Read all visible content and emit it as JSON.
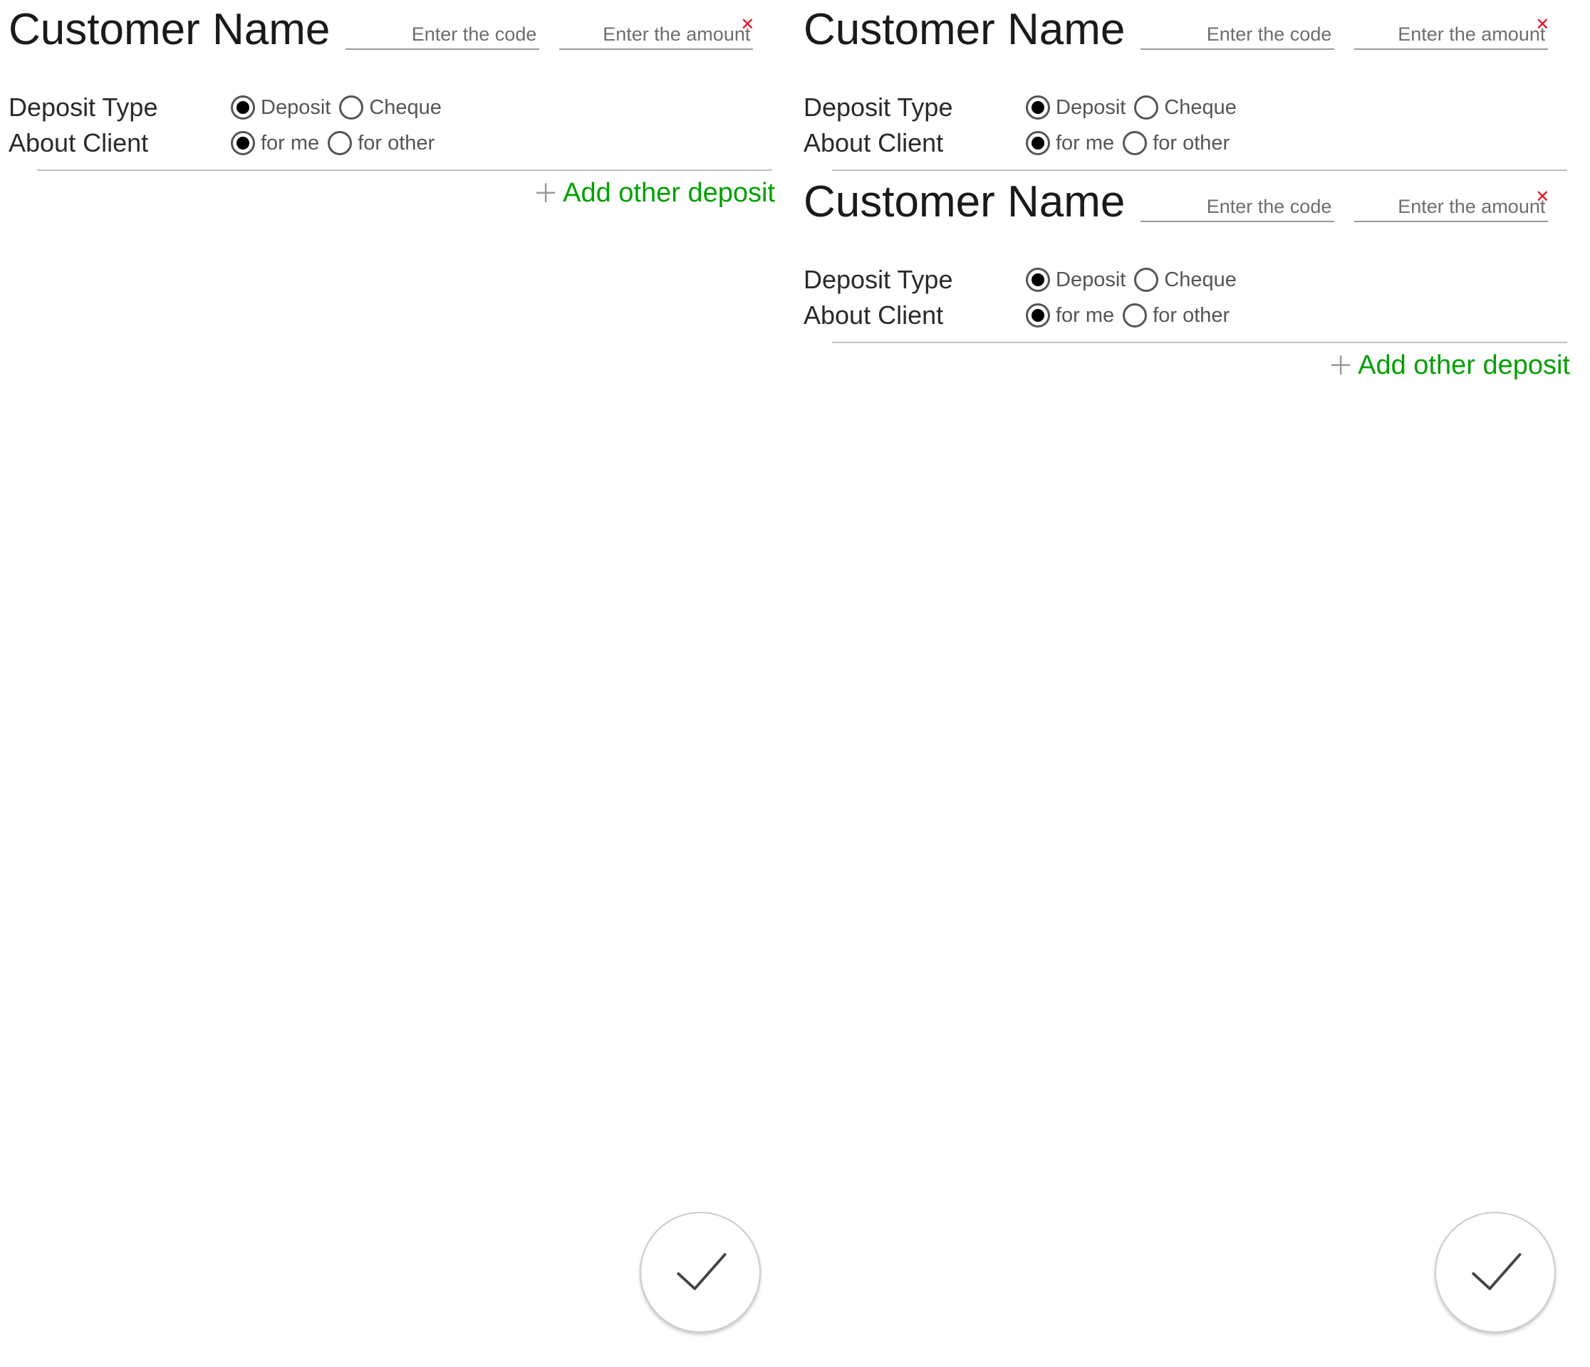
{
  "left": {
    "deposits": [
      {
        "title": "Customer Name",
        "code_placeholder": "Enter the code",
        "amount_placeholder": "Enter the amount",
        "deposit_type_label": "Deposit Type",
        "about_client_label": "About Client",
        "type_options": {
          "deposit": "Deposit",
          "cheque": "Cheque"
        },
        "client_options": {
          "for_me": "for me",
          "for_other": "for other"
        },
        "selected_type": "deposit",
        "selected_client": "for_me"
      }
    ],
    "add_other_label": "Add other deposit"
  },
  "right": {
    "deposits": [
      {
        "title": "Customer Name",
        "code_placeholder": "Enter the code",
        "amount_placeholder": "Enter the amount",
        "deposit_type_label": "Deposit Type",
        "about_client_label": "About Client",
        "type_options": {
          "deposit": "Deposit",
          "cheque": "Cheque"
        },
        "client_options": {
          "for_me": "for me",
          "for_other": "for other"
        },
        "selected_type": "deposit",
        "selected_client": "for_me"
      },
      {
        "title": "Customer Name",
        "code_placeholder": "Enter the code",
        "amount_placeholder": "Enter the amount",
        "deposit_type_label": "Deposit Type",
        "about_client_label": "About Client",
        "type_options": {
          "deposit": "Deposit",
          "cheque": "Cheque"
        },
        "client_options": {
          "for_me": "for me",
          "for_other": "for other"
        },
        "selected_type": "deposit",
        "selected_client": "for_me"
      }
    ],
    "add_other_label": "Add other deposit"
  }
}
